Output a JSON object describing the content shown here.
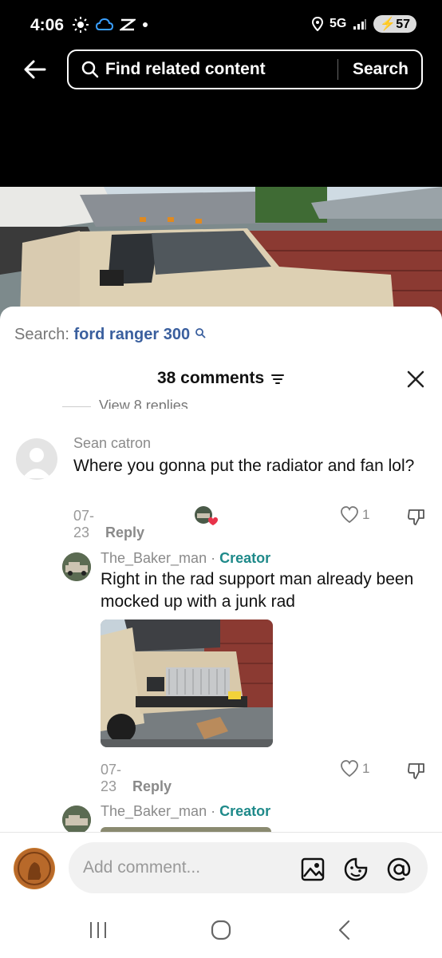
{
  "status": {
    "time": "4:06",
    "network": "5G",
    "battery": "57"
  },
  "search_bar": {
    "query": "Find related content",
    "button": "Search"
  },
  "sheet": {
    "search_label": "Search:",
    "search_term": "ford ranger 300",
    "comments_count": "38 comments",
    "view_replies": "View 8 replies"
  },
  "comments": [
    {
      "author": "Sean catron",
      "text": "Where you gonna put the radiator and fan lol?",
      "date": "07-23",
      "reply": "Reply",
      "likes": "1"
    },
    {
      "author": "The_Baker_man",
      "sep": " · ",
      "badge": "Creator",
      "text": "Right in the rad support man already been mocked up with a junk rad",
      "date": "07-23",
      "reply": "Reply",
      "likes": "1"
    },
    {
      "author": "The_Baker_man",
      "sep": " · ",
      "badge": "Creator"
    }
  ],
  "composer": {
    "placeholder": "Add comment..."
  },
  "icons": {
    "back": "back-arrow-icon",
    "search": "search-icon",
    "sort": "sort-icon",
    "close": "close-icon",
    "heart": "heart-icon",
    "dislike": "dislike-icon",
    "image": "image-icon",
    "emoji": "emoji-icon",
    "mention": "mention-icon"
  },
  "colors": {
    "creator": "#1f8a8a",
    "search_term": "#3a5f9e",
    "like_badge": "#e8334a"
  }
}
